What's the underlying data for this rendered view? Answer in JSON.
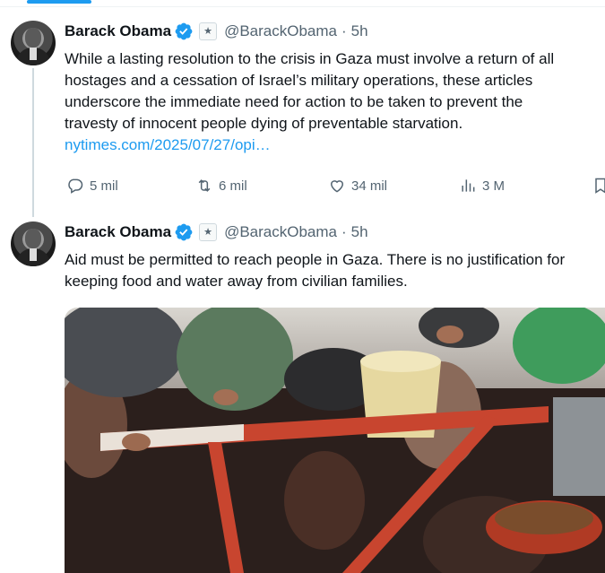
{
  "tweets": [
    {
      "name": "Barack Obama",
      "handle": "@BarackObama",
      "separator": "·",
      "time": "5h",
      "lines": [
        "While a lasting resolution to the crisis in Gaza must involve a return of all",
        "hostages and a cessation of Israel’s military operations, these articles",
        "underscore the immediate need for action to be taken to prevent the",
        "travesty of innocent people dying of preventable starvation."
      ],
      "link": "nytimes.com/2025/07/27/opi…",
      "stats": {
        "replies": "5 mil",
        "reposts": "6 mil",
        "likes": "34 mil",
        "views": "3 M"
      }
    },
    {
      "name": "Barack Obama",
      "handle": "@BarackObama",
      "separator": "·",
      "time": "5h",
      "lines": [
        "Aid must be permitted to reach people in Gaza. There is no justification for",
        "keeping food and water away from civilian families."
      ]
    }
  ],
  "icons": {
    "verified": "verified-badge-icon",
    "government": "government-seal-icon",
    "reply": "reply-icon",
    "repost": "repost-icon",
    "like": "heart-icon",
    "views": "views-chart-icon",
    "bookmark": "bookmark-icon"
  },
  "colors": {
    "accent": "#1d9bf0",
    "text": "#0f1419",
    "muted": "#536471"
  }
}
